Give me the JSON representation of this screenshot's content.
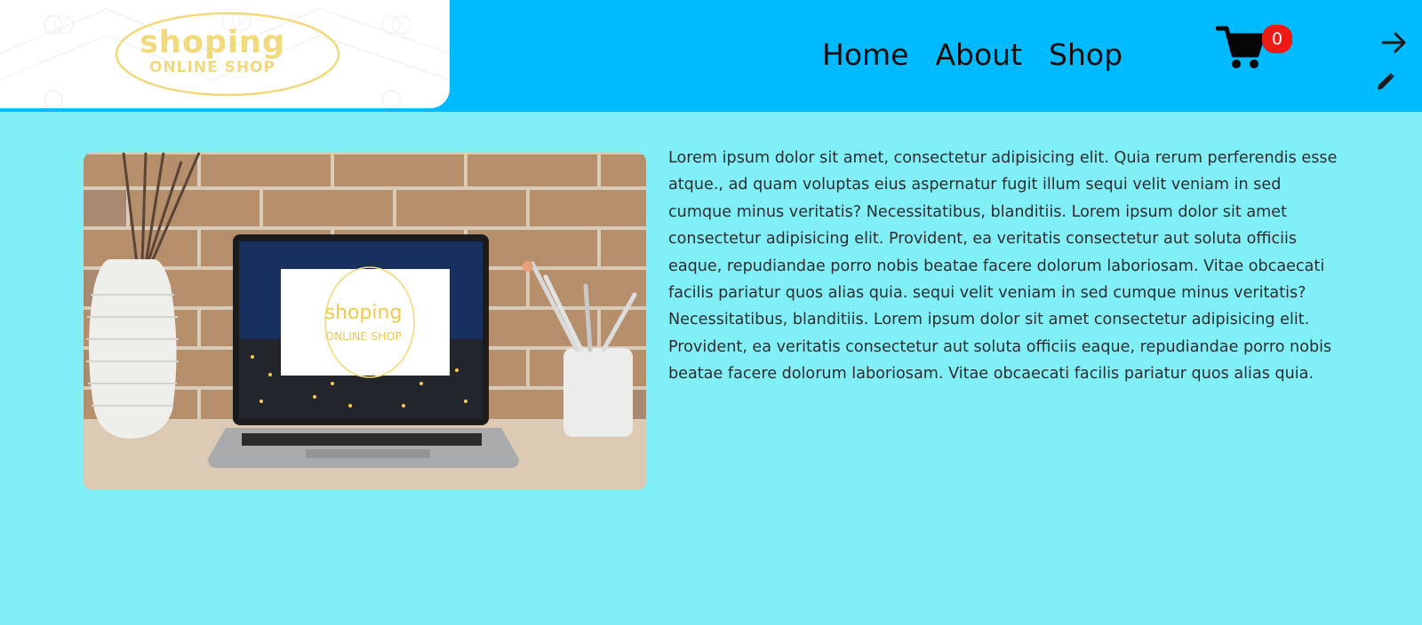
{
  "header": {
    "logo": {
      "line1": "shoping",
      "line2": "ONLINE SHOP",
      "alt": "shoping online shop logo"
    },
    "nav": [
      {
        "label": "Home"
      },
      {
        "label": "About"
      },
      {
        "label": "Shop"
      }
    ],
    "cart": {
      "icon": "shopping-cart-icon",
      "count": "0"
    },
    "actions": [
      {
        "icon": "arrow-right-icon"
      },
      {
        "icon": "pencil-edit-icon"
      }
    ]
  },
  "main": {
    "image": {
      "description": "laptop on desk showing shop logo",
      "screen_logo": {
        "line1": "shoping",
        "line2": "ONLINE SHOP"
      }
    },
    "text": "Lorem ipsum dolor sit amet, consectetur adipisicing elit. Quia rerum perferendis esse atque., ad quam voluptas eius aspernatur fugit illum sequi velit veniam in sed cumque minus veritatis? Necessitatibus, blanditiis. Lorem ipsum dolor sit amet consectetur adipisicing elit. Provident, ea veritatis consectetur aut soluta officiis eaque, repudiandae porro nobis beatae facere dolorum laboriosam. Vitae obcaecati facilis pariatur quos alias quia. sequi velit veniam in sed cumque minus veritatis? Necessitatibus, blanditiis. Lorem ipsum dolor sit amet consectetur adipisicing elit. Provident, ea veritatis consectetur aut soluta officiis eaque, repudiandae porro nobis beatae facere dolorum laboriosam. Vitae obcaecati facilis pariatur quos alias quia."
  },
  "colors": {
    "page_bg": "#81f0f6",
    "header_bg": "#00baff",
    "logo_gold": "#f1d97e",
    "badge_red": "#ee1b14"
  }
}
